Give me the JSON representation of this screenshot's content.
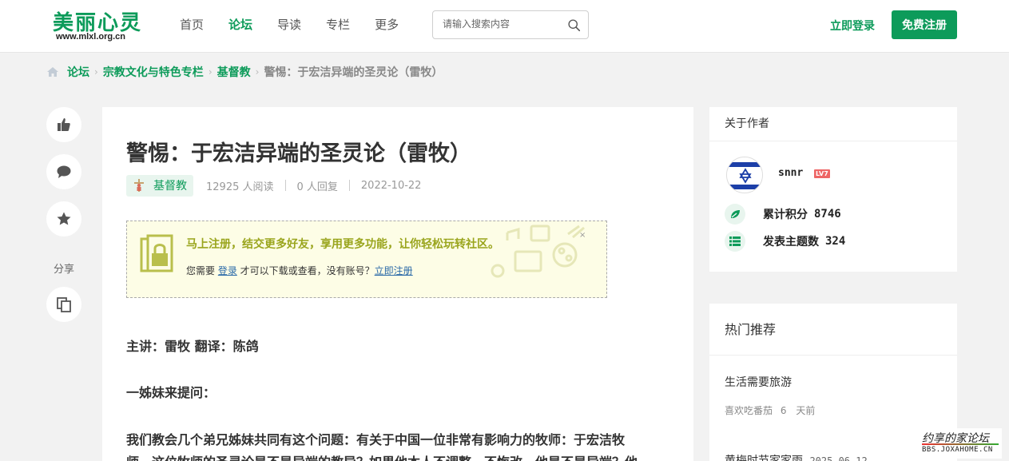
{
  "header": {
    "logo_title": "美丽心灵",
    "logo_url": "www.mlxl.org.cn",
    "nav": [
      "首页",
      "论坛",
      "导读",
      "专栏",
      "更多"
    ],
    "nav_active": "论坛",
    "search_placeholder": "请输入搜索内容",
    "login_label": "立即登录",
    "register_label": "免费注册"
  },
  "breadcrumb": [
    "论坛",
    "宗教文化与特色专栏",
    "基督教"
  ],
  "breadcrumb_current": "警惕：于宏洁异端的圣灵论（雷牧）",
  "rail": {
    "share_label": "分享"
  },
  "article": {
    "title": "警惕：于宏洁异端的圣灵论（雷牧）",
    "category": "基督教",
    "views": "12925 人阅读",
    "replies": "0 人回复",
    "date": "2022-10-22",
    "notice": {
      "headline": "马上注册，结交更多好友，享用更多功能，让你轻松玩转社区。",
      "text_before": "您需要 ",
      "login_link": "登录",
      "text_middle": " 才可以下载或查看，没有账号？",
      "register_link": "立即注册"
    },
    "paragraphs": [
      "主讲：雷牧  翻译：陈鸽",
      "一姊妹来提问：",
      "我们教会几个弟兄姊妹共同有这个问题：有关于中国一位非常有影响力的牧师：于宏洁牧",
      "师，这位牧师的圣灵论是不是异端的教导？如果他本人不调整、不悔改，他是不是异端？他"
    ]
  },
  "author": {
    "section_title": "关于作者",
    "name": "snnr",
    "level": "LV7",
    "points_label": "累计积分",
    "points": "8746",
    "topics_label": "发表主题数",
    "topics": "324"
  },
  "hot": {
    "section_title": "热门推荐",
    "items": [
      {
        "title": "生活需要旅游",
        "author": "喜欢吃番茄",
        "count": "6",
        "time": "天前"
      },
      {
        "title": "黄梅时节家家雨",
        "date": "2025-06-12"
      }
    ]
  },
  "watermark": {
    "line1": "约享的家论坛",
    "line2": "BBS.JOXAHOME.CN"
  },
  "colors": {
    "brand": "#0d9b5a",
    "notice_head": "#9aa51d",
    "link": "#2b6aa8"
  }
}
